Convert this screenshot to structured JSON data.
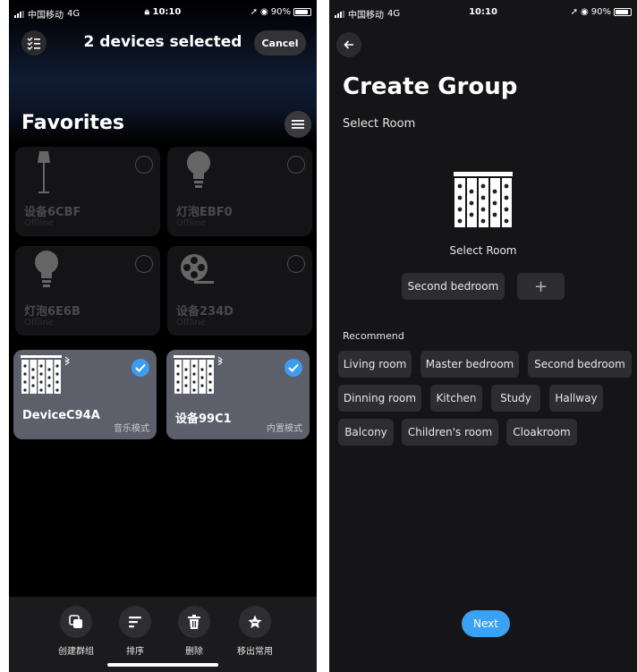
{
  "colors": {
    "accent": "#3ba2f3",
    "check": "#3f9bf0",
    "selected_card": "#5d5f6b",
    "background": "#000000"
  },
  "left": {
    "status": {
      "carrier": "中国移动",
      "network": "4G",
      "time": "10:10",
      "battery": "90%"
    },
    "header": {
      "title": "2 devices selected",
      "cancel": "Cancel",
      "select_icon": "checklist-icon"
    },
    "favorites_title": "Favorites",
    "devices": [
      {
        "name": "设备6CBF",
        "status": "Offline",
        "icon": "floor-lamp-icon",
        "selected": false
      },
      {
        "name": "灯泡EBF0",
        "status": "Offline",
        "icon": "light-bulb-icon",
        "selected": false
      },
      {
        "name": "灯泡6E6B",
        "status": "Offline",
        "icon": "light-bulb-icon",
        "selected": false
      },
      {
        "name": "设备234D",
        "status": "Offline",
        "icon": "film-reel-icon",
        "selected": false
      },
      {
        "name": "DeviceC94A",
        "mode": "音乐模式",
        "icon": "curtain-icon",
        "selected": true
      },
      {
        "name": "设备99C1",
        "mode": "内置模式",
        "icon": "curtain-icon",
        "selected": true
      }
    ],
    "bottom_actions": [
      {
        "label": "创建群组",
        "icon": "create-group-icon"
      },
      {
        "label": "排序",
        "icon": "sort-icon"
      },
      {
        "label": "删除",
        "icon": "trash-icon"
      },
      {
        "label": "移出常用",
        "icon": "star-icon"
      }
    ]
  },
  "right": {
    "status": {
      "carrier": "中国移动",
      "network": "4G",
      "time": "10:10",
      "battery": "90%"
    },
    "title": "Create Group",
    "subtitle": "Select Room",
    "room_label": "Select Room",
    "selected_room": "Second bedroom",
    "add_label": "+",
    "recommend_title": "Recommend",
    "recommend": [
      "Living room",
      "Master bedroom",
      "Second bedroom",
      "Dinning room",
      "Kitchen",
      "Study",
      "Hallway",
      "Balcony",
      "Children's room",
      "Cloakroom"
    ],
    "next": "Next"
  }
}
